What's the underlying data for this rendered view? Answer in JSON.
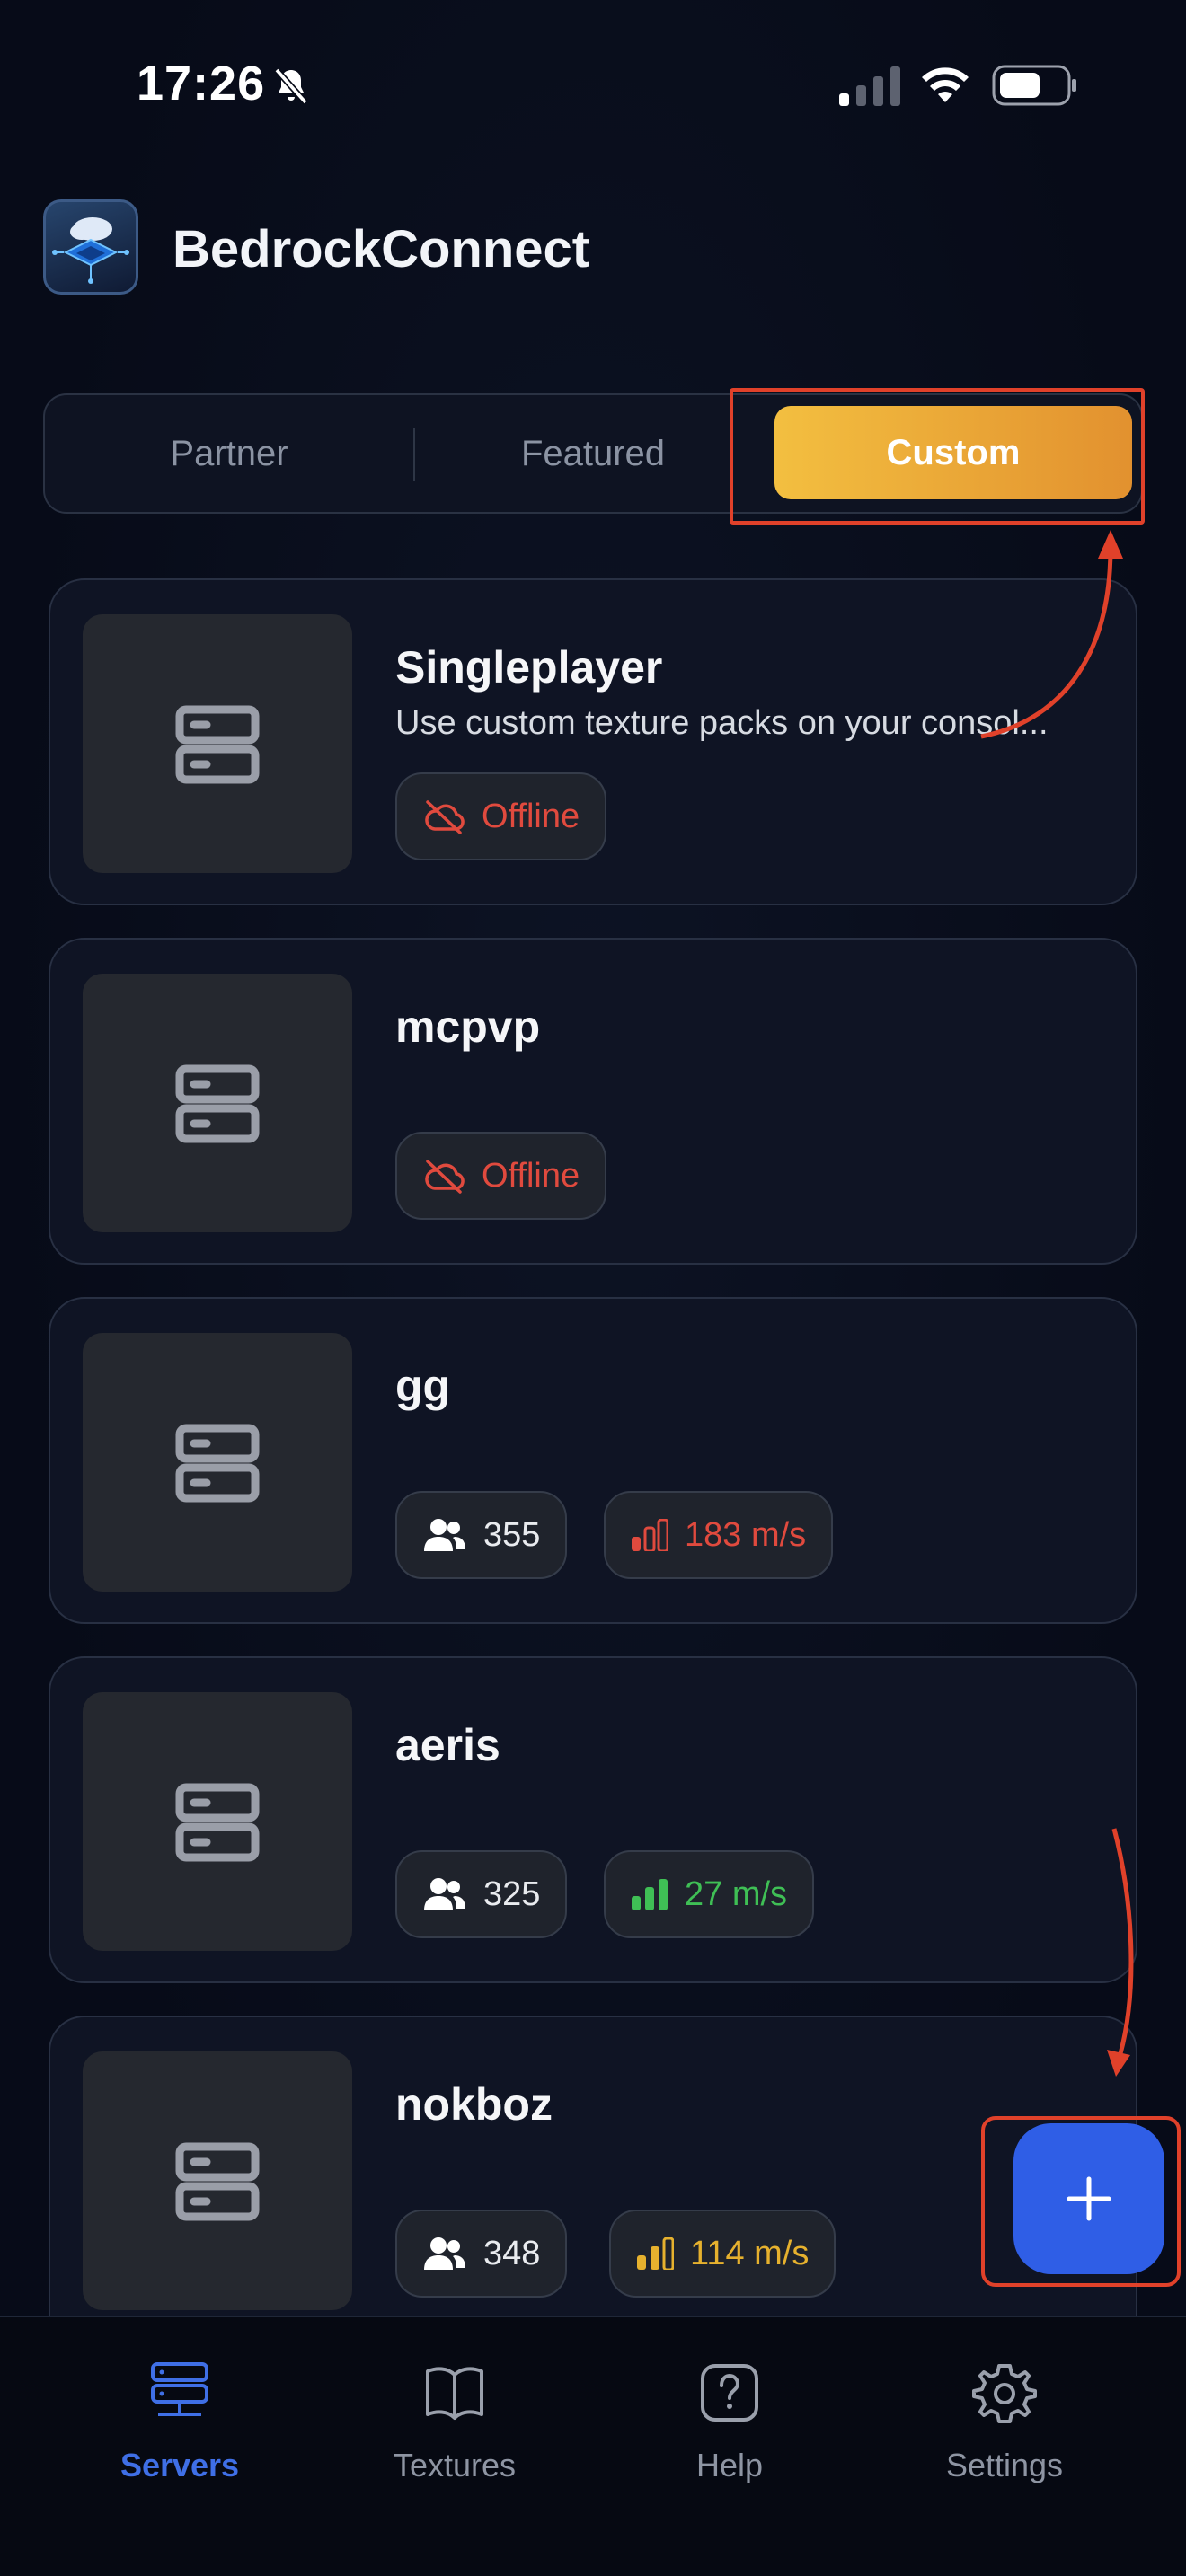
{
  "status_bar": {
    "time": "17:26",
    "icons": [
      "bell-slash-icon",
      "cellular-signal-icon",
      "wifi-icon",
      "battery-icon"
    ]
  },
  "header": {
    "app_name": "BedrockConnect",
    "logo_icon": "cloud-server-logo-icon"
  },
  "tabs": {
    "items": [
      {
        "label": "Partner",
        "active": false
      },
      {
        "label": "Featured",
        "active": false
      },
      {
        "label": "Custom",
        "active": true
      }
    ],
    "active_gradient": [
      "#f3bf40",
      "#e2912f"
    ]
  },
  "servers": [
    {
      "name": "Singleplayer",
      "description": "Use custom texture packs on your consol...",
      "status": "Offline",
      "icon": "server-stack-icon"
    },
    {
      "name": "mcpvp",
      "description": "",
      "status": "Offline",
      "icon": "server-stack-icon"
    },
    {
      "name": "gg",
      "players": "355",
      "ping": "183 m/s",
      "ping_color": "#e04a3e",
      "ping_bars": 1,
      "icon": "server-stack-icon"
    },
    {
      "name": "aeris",
      "players": "325",
      "ping": "27 m/s",
      "ping_color": "#3fbf55",
      "ping_bars": 3,
      "icon": "server-stack-icon"
    },
    {
      "name": "nokboz",
      "players": "348",
      "ping": "114 m/s",
      "ping_color": "#e6b12e",
      "ping_bars": 2,
      "icon": "server-stack-icon"
    }
  ],
  "fab": {
    "icon": "plus-icon",
    "color": "#2f5ee6"
  },
  "bottom_nav": [
    {
      "label": "Servers",
      "icon": "server-stack-icon",
      "active": true
    },
    {
      "label": "Textures",
      "icon": "open-book-icon",
      "active": false
    },
    {
      "label": "Help",
      "icon": "question-mark-icon",
      "active": false
    },
    {
      "label": "Settings",
      "icon": "gear-icon",
      "active": false
    }
  ],
  "colors": {
    "accent": "#3f6fe6",
    "annotation": "#e0412a",
    "offline": "#e04a3e"
  }
}
